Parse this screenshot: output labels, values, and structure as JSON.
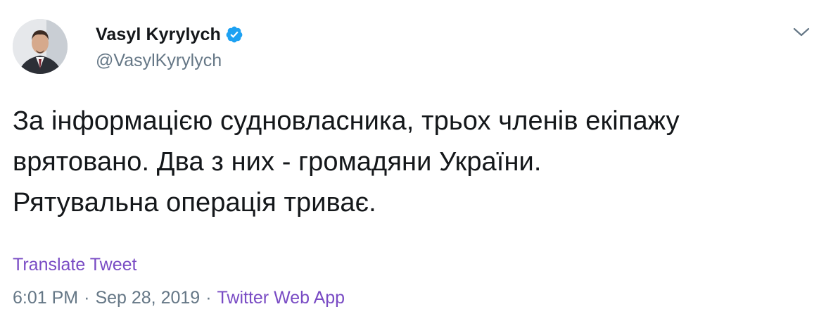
{
  "tweet": {
    "author": {
      "display_name": "Vasyl Kyrylych",
      "handle": "@VasylKyrylych",
      "verified": true,
      "avatar_icon": "user-avatar"
    },
    "menu_icon": "chevron-down-icon",
    "text": "За інформацією судновласника, трьох членів екіпажу\nврятовано. Два з них - громадяни України.\nРятувальна операція триває.",
    "translate_label": "Translate Tweet",
    "time": "6:01 PM",
    "separator": "·",
    "date": "Sep 28, 2019",
    "source": "Twitter Web App"
  },
  "colors": {
    "text": "#14171a",
    "secondary": "#657786",
    "accent_purple": "#794bc4",
    "verified_blue": "#1da1f2"
  }
}
